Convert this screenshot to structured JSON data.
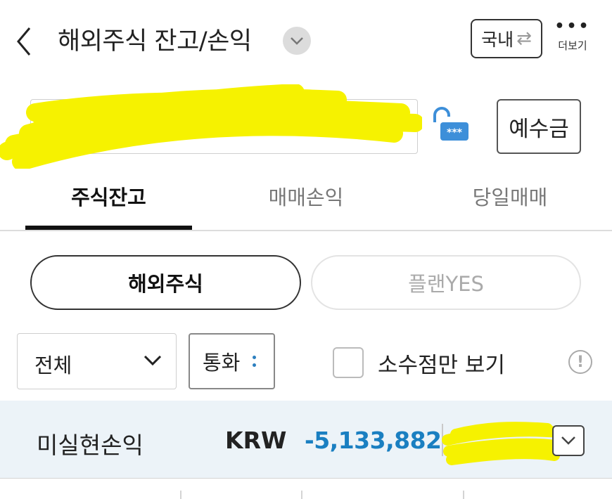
{
  "header": {
    "back_icon": "chevron-left-icon",
    "title": "해외주식 잔고/손익",
    "title_dropdown_icon": "chevron-down-icon",
    "domestic_label": "국내",
    "swap_icon": "swap-arrows-icon",
    "more_label": "더보기",
    "more_icon": "more-dots-icon"
  },
  "account": {
    "number_text": "··· - ·· - ···",
    "chevron_icon": "chevron-down-icon",
    "lock_icon": "unlock-password-icon",
    "lock_mask": "***",
    "deposit_label": "예수금"
  },
  "tabs": [
    {
      "label": "주식잔고",
      "active": true
    },
    {
      "label": "매매손익",
      "active": false
    },
    {
      "label": "당일매매",
      "active": false
    }
  ],
  "segments": [
    {
      "label": "해외주식",
      "active": true
    },
    {
      "label": "플랜YES",
      "active": false
    }
  ],
  "filters": {
    "scope_value": "전체",
    "currency_label": "통화",
    "fraction_only_label": "소수점만 보기",
    "fraction_only_checked": false,
    "info_icon": "info-circle-icon"
  },
  "summary": {
    "label": "미실현손익",
    "currency": "KRW",
    "value": "-5,133,882",
    "expand_icon": "chevron-down-icon"
  },
  "colors": {
    "accent_blue": "#1a7fc1",
    "lock_blue": "#3d8fd9",
    "summary_bg": "#ecf3f8",
    "redaction_yellow": "#f6f200"
  }
}
